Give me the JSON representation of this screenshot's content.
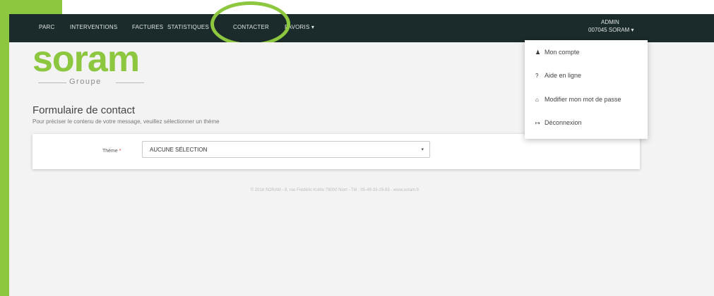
{
  "nav": {
    "items": [
      "PARC",
      "INTERVENTIONS",
      "FACTURES",
      "STATISTIQUES",
      "CONTACTER",
      "FAVORIS ▾"
    ]
  },
  "user": {
    "role": "ADMIN",
    "account": "007045 SORAM ▾"
  },
  "logo": {
    "word": "soram",
    "sub": "Groupe"
  },
  "form": {
    "title": "Formulaire de contact",
    "subtitle": "Pour préciser le contenu de votre message, veuillez sélectionner un thème",
    "theme_label": "Thème",
    "theme_required": "*",
    "select_value": "AUCUNE SÉLECTION",
    "select_caret": "▾"
  },
  "footer": "© 2018 SORAM - 8, rue Frédéric Kuhlo 79000 Niort - Tél : 05-49-33-29-93 - www.soram.fr",
  "dropdown": {
    "items": [
      {
        "icon": "♟",
        "label": "Mon compte"
      },
      {
        "icon": "?",
        "label": "Aide en ligne"
      },
      {
        "icon": "⌂",
        "label": "Modifier mon mot de passe"
      },
      {
        "icon": "↦",
        "label": "Déconnexion"
      }
    ]
  },
  "colors": {
    "accent": "#8dc63f",
    "navbar": "#1b2a2a"
  }
}
